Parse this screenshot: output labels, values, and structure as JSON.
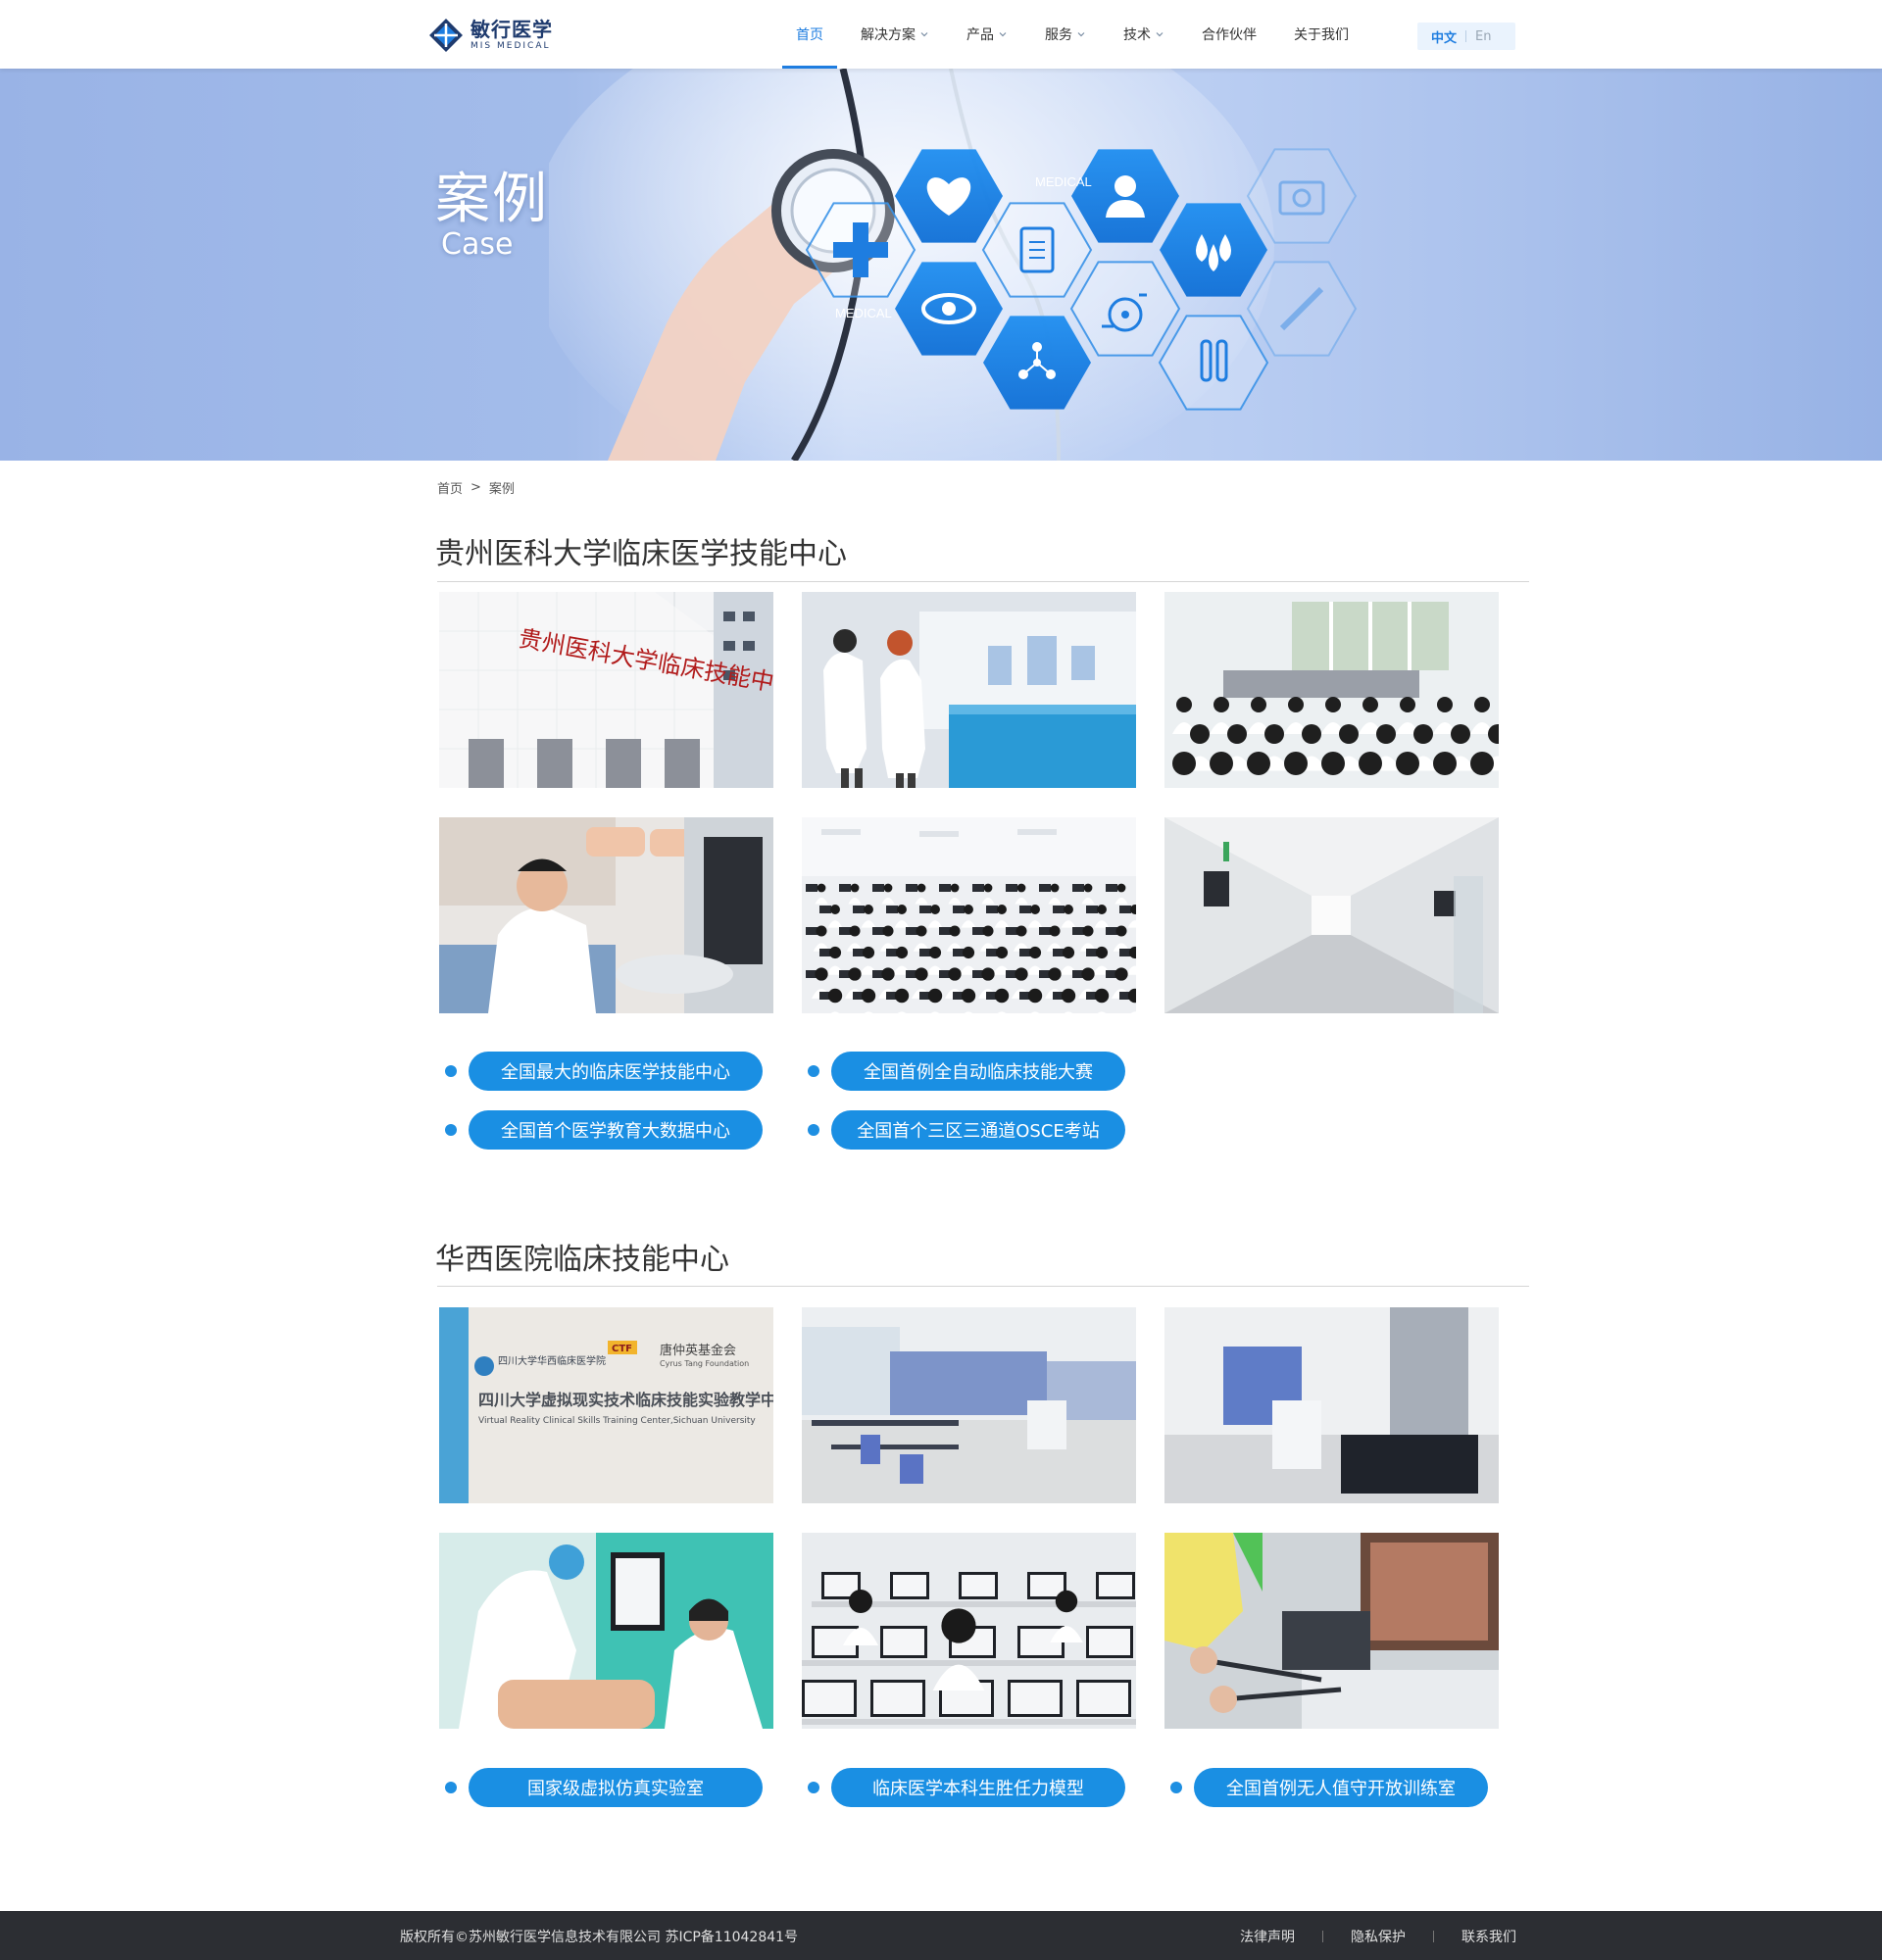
{
  "brand": {
    "name_cn": "敏行医学",
    "name_en": "MIS MEDICAL"
  },
  "nav": {
    "items": [
      {
        "label": "首页",
        "dropdown": false,
        "active": true
      },
      {
        "label": "解决方案",
        "dropdown": true,
        "active": false
      },
      {
        "label": "产品",
        "dropdown": true,
        "active": false
      },
      {
        "label": "服务",
        "dropdown": true,
        "active": false
      },
      {
        "label": "技术",
        "dropdown": true,
        "active": false
      },
      {
        "label": "合作伙伴",
        "dropdown": false,
        "active": false
      },
      {
        "label": "关于我们",
        "dropdown": false,
        "active": false
      }
    ],
    "lang": {
      "zh": "中文",
      "en": "En",
      "selected": "中文"
    }
  },
  "banner": {
    "title_cn": "案例",
    "title_en": "Case",
    "art_labels": [
      "MEDICAL",
      "MEDICAL"
    ]
  },
  "breadcrumb": {
    "home": "首页",
    "sep": ">",
    "current": "案例"
  },
  "sections": [
    {
      "title": "贵州医科大学临床医学技能中心",
      "photos": [
        "building-entrance",
        "presentation-room",
        "classroom-demo",
        "student-simulator",
        "exam-hall-computers",
        "corridor"
      ],
      "tags": [
        "全国最大的临床医学技能中心",
        "全国首例全自动临床技能大赛",
        "全国首个医学教育大数据中心",
        "全国首个三区三通道OSCE考站"
      ]
    },
    {
      "title": "华西医院临床技能中心",
      "photos": [
        "foundation-wall-sign",
        "training-room",
        "equipment-room",
        "nurse-manikin",
        "computer-lab",
        "surgical-simulator"
      ],
      "photo_sign": {
        "school": "四川大学华西临床医学院",
        "foundation_cn": "唐仲英基金会",
        "foundation_en": "Cyrus Tang Foundation",
        "center_cn": "四川大学虚拟现实技术临床技能实验教学中心",
        "center_en": "Virtual Reality Clinical Skills Training Center,Sichuan University",
        "ctf": "CTF"
      },
      "tags": [
        "国家级虚拟仿真实验室",
        "临床医学本科生胜任力模型",
        "全国首例无人值守开放训练室"
      ]
    }
  ],
  "photo_text": {
    "guizhou_sign": "贵州医科大学临床技能中心"
  },
  "footer": {
    "copyright": "版权所有©苏州敏行医学信息技术有限公司  苏ICP备11042841号",
    "links": [
      "法律声明",
      "隐私保护",
      "联系我们"
    ]
  },
  "colors": {
    "accent": "#1e7de0",
    "pill": "#1a8fe3",
    "footer_bg": "#2c2e33",
    "banner": "#a3bcea"
  }
}
